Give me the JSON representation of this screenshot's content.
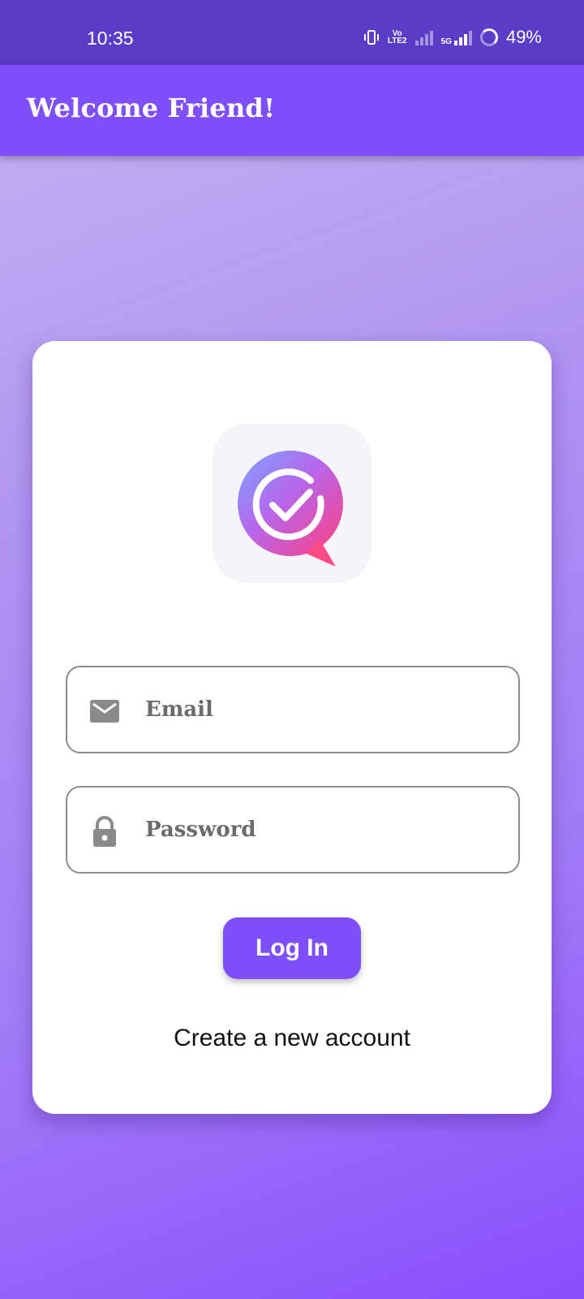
{
  "status_bar": {
    "time": "10:35",
    "network_label_top": "Vo",
    "network_label_bottom": "LTE2",
    "fiveg_label": "5G",
    "battery": "49%"
  },
  "app_bar": {
    "title": "Welcome Friend!"
  },
  "login": {
    "email_placeholder": "Email",
    "password_placeholder": "Password",
    "login_label": "Log In",
    "create_account_label": "Create a new account"
  },
  "icons": {
    "email": "mail-icon",
    "password": "lock-icon",
    "logo": "chat-check-logo"
  },
  "colors": {
    "accent": "#7e50fc",
    "status_bar": "#5a3cc6"
  }
}
